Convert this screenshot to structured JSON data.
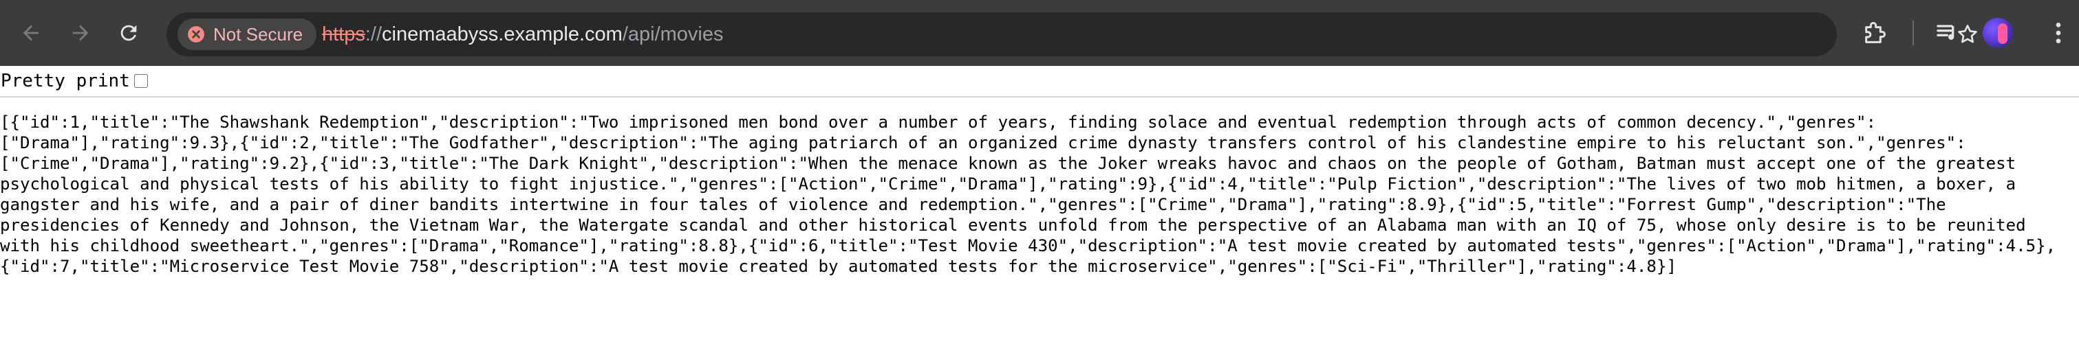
{
  "browser": {
    "security_chip": "Not Secure",
    "url_scheme": "https",
    "url_separator": "://",
    "url_host": "cinemaabyss.example.com",
    "url_path": "/api/movies",
    "accent_warning": "#f28b82"
  },
  "viewer": {
    "pretty_print_label": "Pretty print",
    "pretty_print_checked": false
  },
  "response": {
    "raw_json": "[{\"id\":1,\"title\":\"The Shawshank Redemption\",\"description\":\"Two imprisoned men bond over a number of years, finding solace and eventual redemption through acts of common decency.\",\"genres\":[\"Drama\"],\"rating\":9.3},{\"id\":2,\"title\":\"The Godfather\",\"description\":\"The aging patriarch of an organized crime dynasty transfers control of his clandestine empire to his reluctant son.\",\"genres\":[\"Crime\",\"Drama\"],\"rating\":9.2},{\"id\":3,\"title\":\"The Dark Knight\",\"description\":\"When the menace known as the Joker wreaks havoc and chaos on the people of Gotham, Batman must accept one of the greatest psychological and physical tests of his ability to fight injustice.\",\"genres\":[\"Action\",\"Crime\",\"Drama\"],\"rating\":9},{\"id\":4,\"title\":\"Pulp Fiction\",\"description\":\"The lives of two mob hitmen, a boxer, a gangster and his wife, and a pair of diner bandits intertwine in four tales of violence and redemption.\",\"genres\":[\"Crime\",\"Drama\"],\"rating\":8.9},{\"id\":5,\"title\":\"Forrest Gump\",\"description\":\"The presidencies of Kennedy and Johnson, the Vietnam War, the Watergate scandal and other historical events unfold from the perspective of an Alabama man with an IQ of 75, whose only desire is to be reunited with his childhood sweetheart.\",\"genres\":[\"Drama\",\"Romance\"],\"rating\":8.8},{\"id\":6,\"title\":\"Test Movie 430\",\"description\":\"A test movie created by automated tests\",\"genres\":[\"Action\",\"Drama\"],\"rating\":4.5},{\"id\":7,\"title\":\"Microservice Test Movie 758\",\"description\":\"A test movie created by automated tests for the microservice\",\"genres\":[\"Sci-Fi\",\"Thriller\"],\"rating\":4.8}]"
  },
  "icons": {
    "back": "arrow-left",
    "forward": "arrow-right",
    "reload": "reload",
    "warning": "warning-circle",
    "bookmark": "star-outline",
    "extensions": "puzzle-piece",
    "media": "media-playlist",
    "menu": "three-dots-vertical"
  }
}
